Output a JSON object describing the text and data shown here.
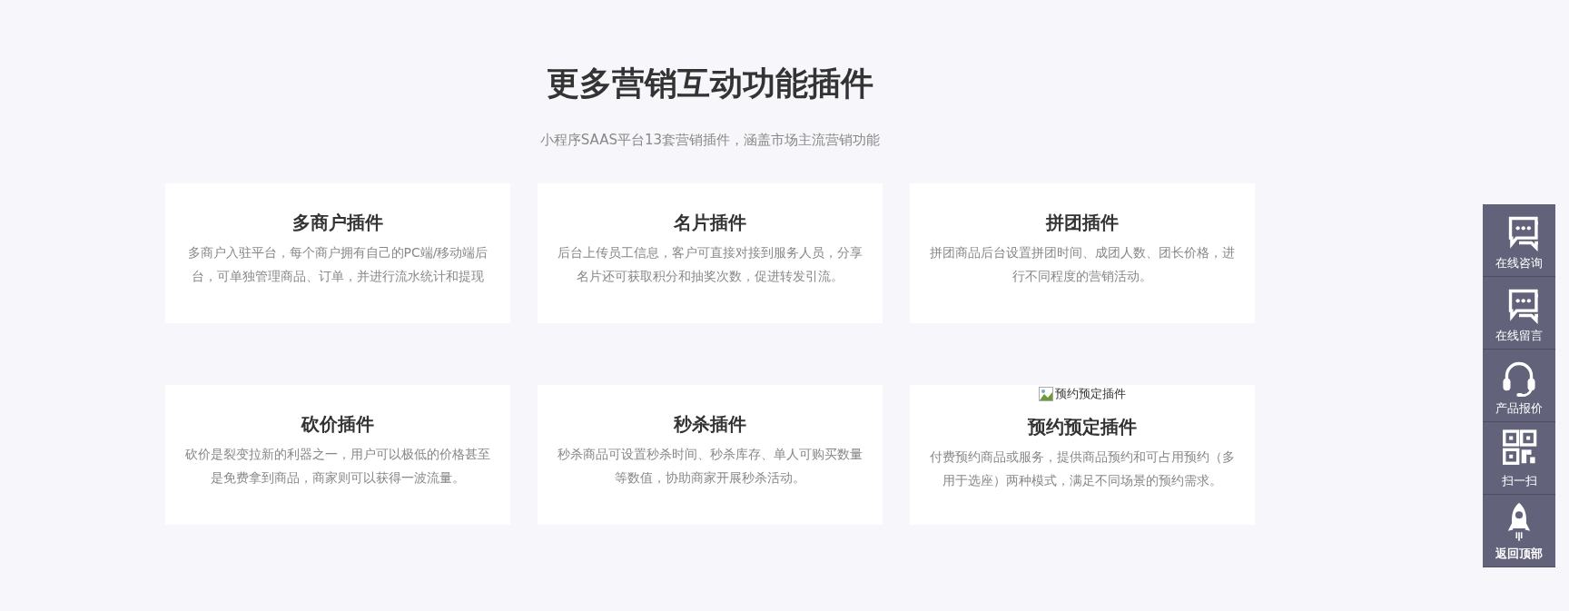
{
  "section": {
    "title": "更多营销互动功能插件",
    "subtitle": "小程序SAAS平台13套营销插件，涵盖市场主流营销功能"
  },
  "cards": [
    {
      "title": "多商户插件",
      "description": "多商户入驻平台，每个商户拥有自己的PC端/移动端后台，可单独管理商品、订单，并进行流水统计和提现"
    },
    {
      "title": "名片插件",
      "description": "后台上传员工信息，客户可直接对接到服务人员，分享名片还可获取积分和抽奖次数，促进转发引流。"
    },
    {
      "title": "拼团插件",
      "description": "拼团商品后台设置拼团时间、成团人数、团长价格，进行不同程度的营销活动。"
    },
    {
      "title": "砍价插件",
      "description": "砍价是裂变拉新的利器之一，用户可以极低的价格甚至是免费拿到商品，商家则可以获得一波流量。"
    },
    {
      "title": "秒杀插件",
      "description": "秒杀商品可设置秒杀时间、秒杀库存、单人可购买数量等数值，协助商家开展秒杀活动。"
    },
    {
      "title": "预约预定插件",
      "description": "付费预约商品或服务，提供商品预约和可占用预约（多用于选座）两种模式，满足不同场景的预约需求。",
      "image_alt": "预约预定插件"
    }
  ],
  "sidebar": {
    "items": [
      {
        "label": "在线咨询",
        "kind": "chat"
      },
      {
        "label": "在线留言",
        "kind": "chat"
      },
      {
        "label": "产品报价",
        "kind": "headset"
      },
      {
        "label": "扫一扫",
        "kind": "qr"
      },
      {
        "label": "返回顶部",
        "kind": "rocket"
      }
    ]
  }
}
